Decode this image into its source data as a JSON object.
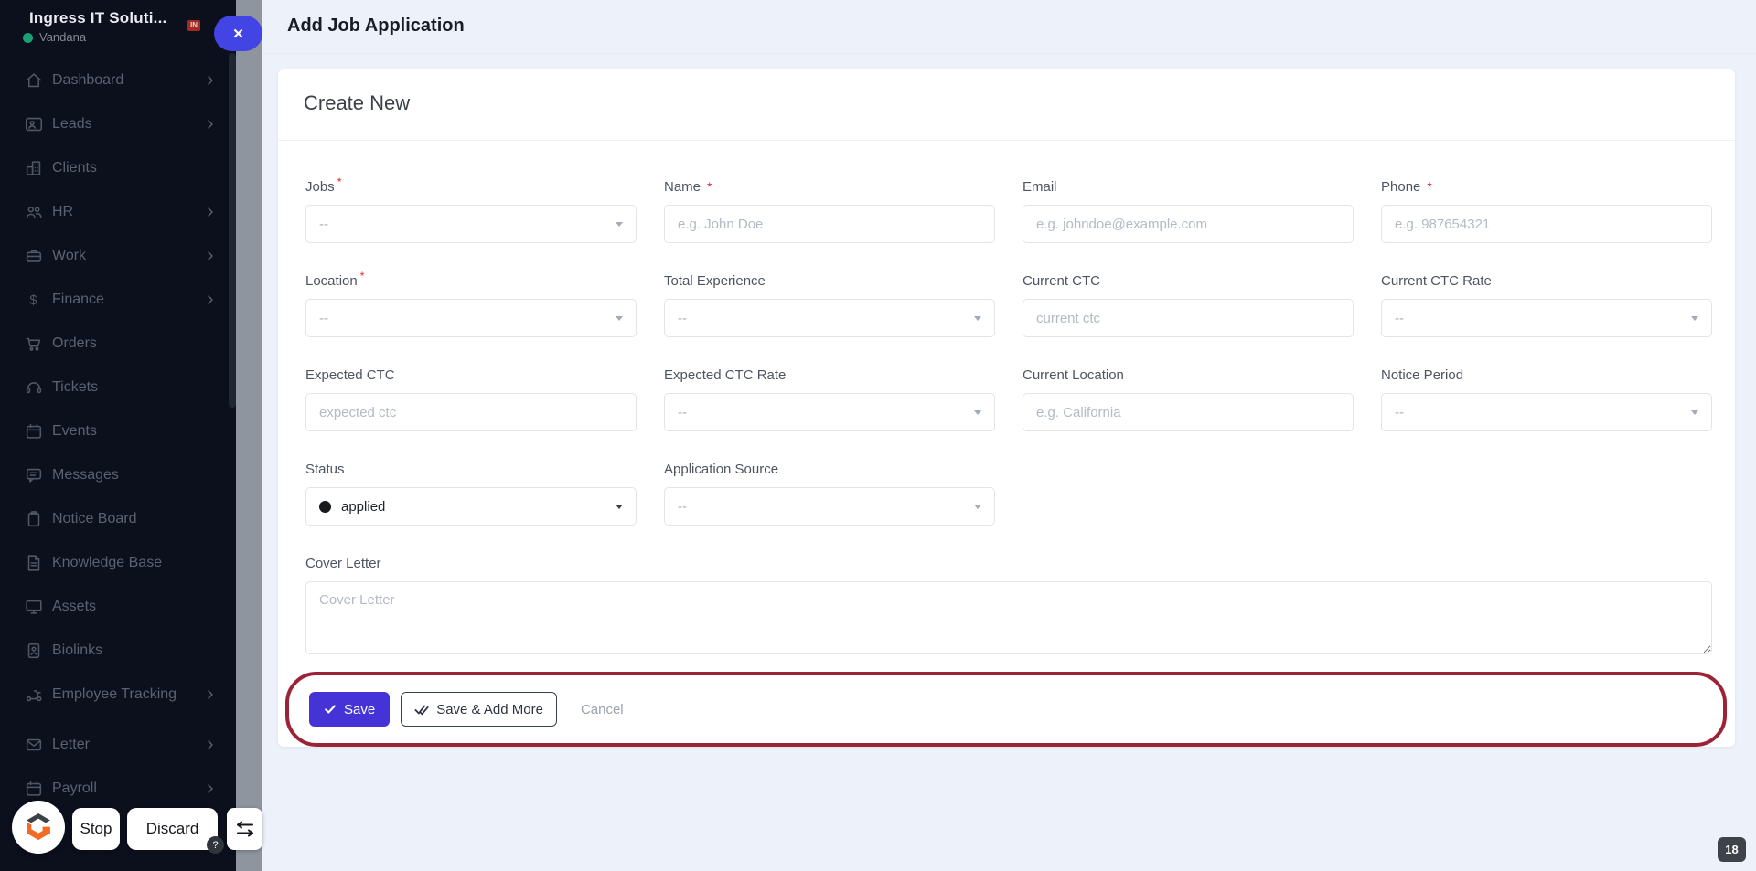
{
  "workspace": {
    "name": "Ingress IT Soluti...",
    "user": "Vandana",
    "badge": "IN",
    "close_label": "✕"
  },
  "sidebar": {
    "items": [
      {
        "label": "Dashboard",
        "icon": "home",
        "chevron": true
      },
      {
        "label": "Leads",
        "icon": "contact-card",
        "chevron": true
      },
      {
        "label": "Clients",
        "icon": "building",
        "chevron": false
      },
      {
        "label": "HR",
        "icon": "users",
        "chevron": true
      },
      {
        "label": "Work",
        "icon": "briefcase",
        "chevron": true
      },
      {
        "label": "Finance",
        "icon": "dollar",
        "chevron": true
      },
      {
        "label": "Orders",
        "icon": "cart",
        "chevron": false
      },
      {
        "label": "Tickets",
        "icon": "headset",
        "chevron": false
      },
      {
        "label": "Events",
        "icon": "calendar",
        "chevron": false
      },
      {
        "label": "Messages",
        "icon": "chat",
        "chevron": false
      },
      {
        "label": "Notice Board",
        "icon": "clipboard",
        "chevron": false
      },
      {
        "label": "Knowledge Base",
        "icon": "file-text",
        "chevron": false
      },
      {
        "label": "Assets",
        "icon": "monitor",
        "chevron": false
      },
      {
        "label": "Biolinks",
        "icon": "id-badge",
        "chevron": false
      },
      {
        "label": "Employee Tracking",
        "icon": "scooter",
        "chevron": true
      },
      {
        "label": "Letter",
        "icon": "envelope",
        "chevron": true
      },
      {
        "label": "Payroll",
        "icon": "calendar",
        "chevron": true
      }
    ]
  },
  "header": {
    "title": "Add Job Application"
  },
  "card": {
    "title": "Create New"
  },
  "form": {
    "fields": [
      {
        "label": "Jobs",
        "required": "sup",
        "type": "select",
        "value": "--"
      },
      {
        "label": "Name",
        "required": "inline",
        "type": "input",
        "placeholder": "e.g. John Doe"
      },
      {
        "label": "Email",
        "required": "",
        "type": "input",
        "placeholder": "e.g. johndoe@example.com"
      },
      {
        "label": "Phone",
        "required": "inline",
        "type": "input",
        "placeholder": "e.g. 987654321"
      },
      {
        "label": "Location",
        "required": "sup",
        "type": "select",
        "value": "--"
      },
      {
        "label": "Total Experience",
        "required": "",
        "type": "select",
        "value": "--"
      },
      {
        "label": "Current CTC",
        "required": "",
        "type": "input",
        "placeholder": "current ctc"
      },
      {
        "label": "Current CTC Rate",
        "required": "",
        "type": "select",
        "value": "--"
      },
      {
        "label": "Expected CTC",
        "required": "",
        "type": "input",
        "placeholder": "expected ctc"
      },
      {
        "label": "Expected CTC Rate",
        "required": "",
        "type": "select",
        "value": "--"
      },
      {
        "label": "Current Location",
        "required": "",
        "type": "input",
        "placeholder": "e.g. California"
      },
      {
        "label": "Notice Period",
        "required": "",
        "type": "select",
        "value": "--"
      },
      {
        "label": "Status",
        "required": "",
        "type": "status",
        "value": "applied"
      },
      {
        "label": "Application Source",
        "required": "",
        "type": "select",
        "value": "--"
      }
    ],
    "cover_letter": {
      "label": "Cover Letter",
      "placeholder": "Cover Letter"
    }
  },
  "footer": {
    "save": "Save",
    "save_add_more": "Save & Add More",
    "cancel": "Cancel"
  },
  "overlay": {
    "stop": "Stop",
    "discard": "Discard",
    "help": "?"
  },
  "page_badge": "18",
  "colors": {
    "primary_button": "#4533d8",
    "close_pill": "#4244e4",
    "highlight_border": "#9b2335",
    "sidebar_bg": "#0c101d",
    "content_bg": "#edf1f9",
    "online_dot": "#18a173",
    "badge_red": "#a32b22",
    "status_dot": "#17191d"
  }
}
